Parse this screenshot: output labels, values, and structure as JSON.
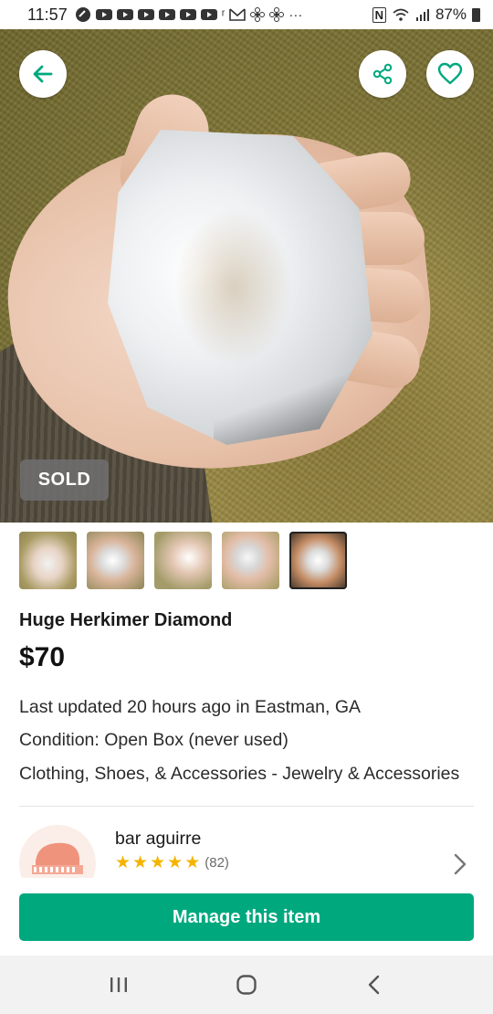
{
  "status_bar": {
    "time": "11:57",
    "icons_left": [
      "link-icon",
      "youtube-icon",
      "youtube-icon",
      "youtube-icon",
      "youtube-icon",
      "youtube-icon",
      "youtube-icon",
      "r-icon",
      "gmail-icon",
      "fan-icon",
      "fan-icon"
    ],
    "more": "···",
    "nfc": "N",
    "battery_percent": "87%"
  },
  "hero": {
    "sold_label": "SOLD",
    "thumbnail_count": 5,
    "active_thumbnail": 5
  },
  "listing": {
    "title": "Huge Herkimer Diamond",
    "price": "$70",
    "updated": "Last updated 20 hours ago in Eastman, GA",
    "condition": "Condition: Open Box (never used)",
    "category": "Clothing, Shoes, & Accessories - Jewelry & Accessories"
  },
  "seller": {
    "name": "bar aguirre",
    "rating_stars": 5,
    "rating_count": "(82)"
  },
  "actions": {
    "manage_label": "Manage this item"
  },
  "colors": {
    "accent": "#00a87e",
    "star": "#f5b400",
    "sold_badge": "#6e6e6e"
  }
}
